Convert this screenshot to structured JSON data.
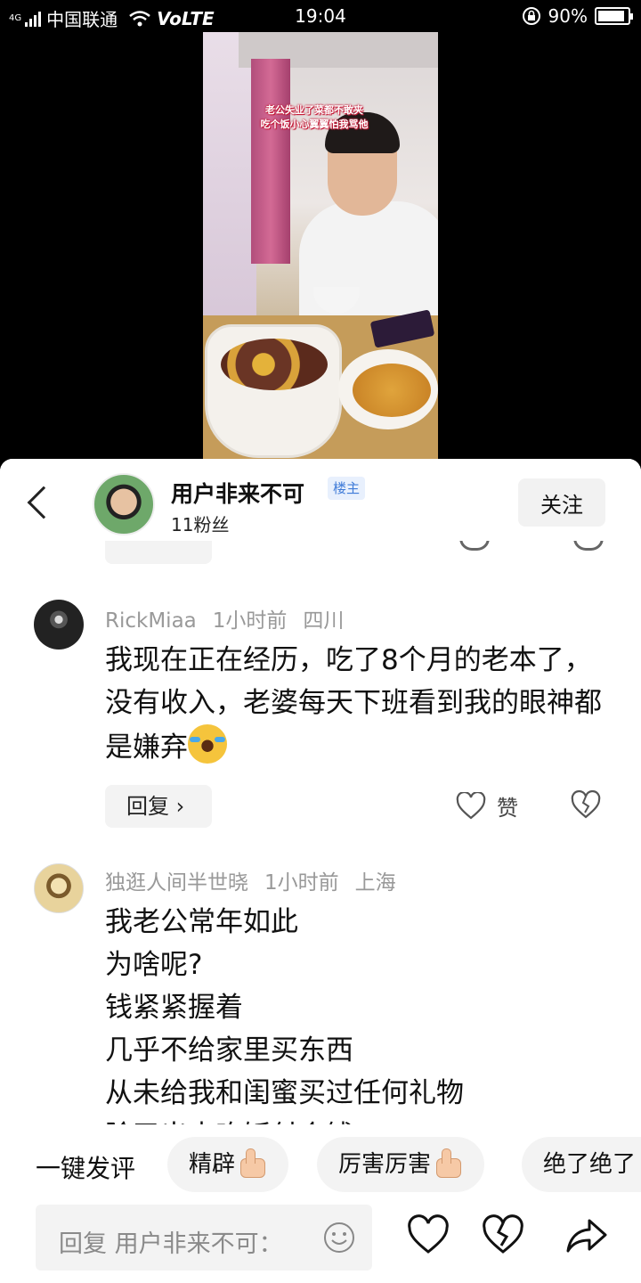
{
  "status_bar": {
    "network_type": "4G",
    "carrier": "中国联通",
    "volte": "VoLTE",
    "time": "19:04",
    "battery_percent": "90%",
    "battery_level": 0.9
  },
  "video": {
    "caption_line1": "老公失业了菜都不敢夹",
    "caption_line2": "吃个饭小心翼翼怕我骂他"
  },
  "header": {
    "user_name": "用户非来不可",
    "owner_badge": "楼主",
    "fans": "11粉丝",
    "follow_label": "关注"
  },
  "comments": [
    {
      "user": "RickMiaa",
      "time": "1小时前",
      "location": "四川",
      "text": "我现在正在经历，吃了8个月的老本了，没有收入，老婆每天下班看到我的眼神都是嫌弃",
      "reply_label": "回复 ›",
      "like_label": "赞"
    },
    {
      "user": "独逛人间半世晓",
      "time": "1小时前",
      "location": "上海",
      "lines": [
        "我老公常年如此",
        "为啥呢?",
        "钱紧紧握着",
        "几乎不给家里买东西",
        "从未给我和闺蜜买过任何礼物",
        "除了出去吃饭付个钱"
      ]
    }
  ],
  "quick_comments": {
    "label": "一键发评",
    "chips": [
      "精辟",
      "厉害厉害",
      "绝了绝了"
    ]
  },
  "input": {
    "placeholder": "回复 用户非来不可："
  },
  "icons": {
    "smile": "smile-icon",
    "heart": "heart-icon",
    "broken_heart": "broken-heart-icon",
    "share": "share-icon"
  }
}
